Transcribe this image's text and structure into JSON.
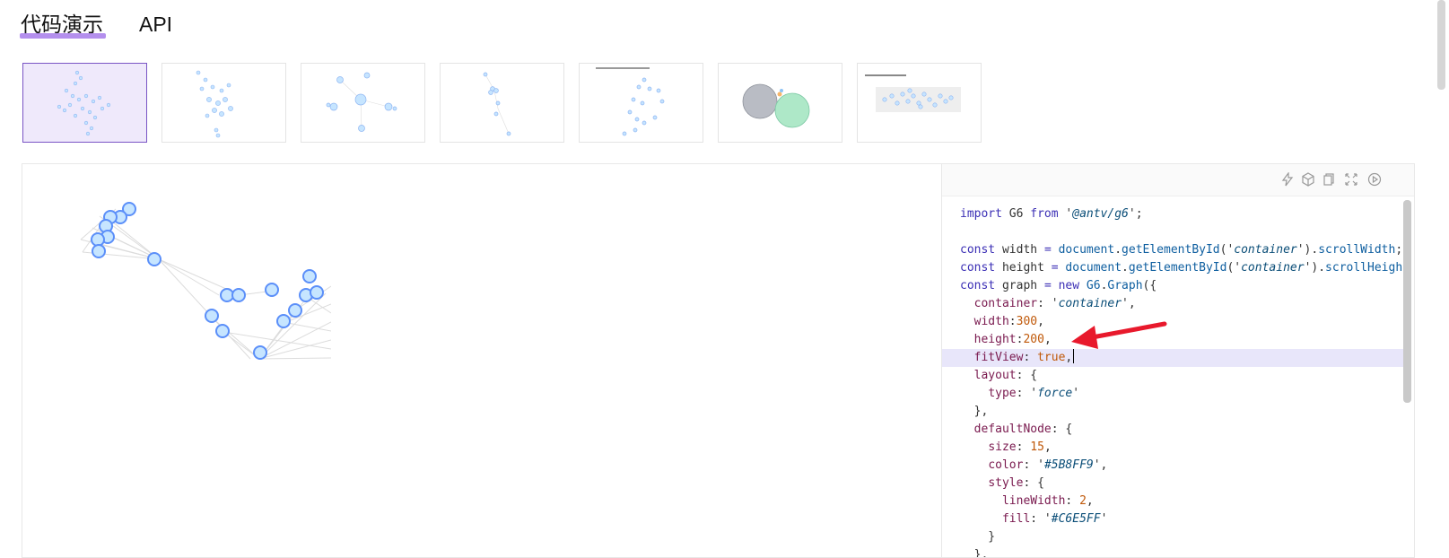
{
  "tabs": [
    {
      "label": "代码演示",
      "active": true
    },
    {
      "label": "API",
      "active": false
    }
  ],
  "colors": {
    "accent": "#a77bea",
    "node_fill": "#C6E5FF",
    "node_stroke": "#5B8FF9",
    "edge": "#d3d3d3",
    "highlight_line": "#e8e6fa",
    "arrow": "#e8192c"
  },
  "thumbnails": [
    {
      "name": "force-layout-demo-1",
      "active": true
    },
    {
      "name": "force-layout-demo-2",
      "active": false
    },
    {
      "name": "force-layout-demo-3",
      "active": false
    },
    {
      "name": "force-layout-demo-4",
      "active": false
    },
    {
      "name": "force-layout-demo-5",
      "active": false
    },
    {
      "name": "force-layout-demo-6",
      "active": false
    },
    {
      "name": "force-layout-demo-7",
      "active": false
    }
  ],
  "toolbar_icons": [
    "lightning-icon",
    "codesandbox-icon",
    "copy-icon",
    "fullscreen-icon",
    "play-icon"
  ],
  "code": {
    "highlighted_line": 9,
    "lines": [
      [
        [
          "kw",
          "import"
        ],
        [
          "plain",
          " G6 "
        ],
        [
          "kw",
          "from"
        ],
        [
          "plain",
          " '"
        ],
        [
          "str",
          "@antv/g6"
        ],
        [
          "plain",
          "';"
        ]
      ],
      [],
      [
        [
          "kw",
          "const"
        ],
        [
          "plain",
          " width "
        ],
        [
          "kw",
          "="
        ],
        [
          "plain",
          " "
        ],
        [
          "fn",
          "document"
        ],
        [
          "plain",
          "."
        ],
        [
          "fn",
          "getElementById"
        ],
        [
          "plain",
          "('"
        ],
        [
          "str",
          "container"
        ],
        [
          "plain",
          "')."
        ],
        [
          "fn",
          "scrollWidth"
        ],
        [
          "plain",
          ";"
        ]
      ],
      [
        [
          "kw",
          "const"
        ],
        [
          "plain",
          " height "
        ],
        [
          "kw",
          "="
        ],
        [
          "plain",
          " "
        ],
        [
          "fn",
          "document"
        ],
        [
          "plain",
          "."
        ],
        [
          "fn",
          "getElementById"
        ],
        [
          "plain",
          "('"
        ],
        [
          "str",
          "container"
        ],
        [
          "plain",
          "')."
        ],
        [
          "fn",
          "scrollHeigh"
        ]
      ],
      [
        [
          "kw",
          "const"
        ],
        [
          "plain",
          " graph "
        ],
        [
          "kw",
          "="
        ],
        [
          "plain",
          " "
        ],
        [
          "kw",
          "new"
        ],
        [
          "plain",
          " "
        ],
        [
          "fn",
          "G6"
        ],
        [
          "plain",
          "."
        ],
        [
          "fn",
          "Graph"
        ],
        [
          "plain",
          "({"
        ]
      ],
      [
        [
          "plain",
          "  "
        ],
        [
          "prop",
          "container"
        ],
        [
          "plain",
          ": '"
        ],
        [
          "str",
          "container"
        ],
        [
          "plain",
          "',"
        ]
      ],
      [
        [
          "plain",
          "  "
        ],
        [
          "prop",
          "width"
        ],
        [
          "plain",
          ":"
        ],
        [
          "num",
          "300"
        ],
        [
          "plain",
          ","
        ]
      ],
      [
        [
          "plain",
          "  "
        ],
        [
          "prop",
          "height"
        ],
        [
          "plain",
          ":"
        ],
        [
          "num",
          "200"
        ],
        [
          "plain",
          ","
        ]
      ],
      [
        [
          "plain",
          "  "
        ],
        [
          "prop",
          "fitView"
        ],
        [
          "plain",
          ": "
        ],
        [
          "num",
          "true"
        ],
        [
          "plain",
          ","
        ]
      ],
      [
        [
          "plain",
          "  "
        ],
        [
          "prop",
          "layout"
        ],
        [
          "plain",
          ": {"
        ]
      ],
      [
        [
          "plain",
          "    "
        ],
        [
          "prop",
          "type"
        ],
        [
          "plain",
          ": '"
        ],
        [
          "str",
          "force"
        ],
        [
          "plain",
          "'"
        ]
      ],
      [
        [
          "plain",
          "  },"
        ]
      ],
      [
        [
          "plain",
          "  "
        ],
        [
          "prop",
          "defaultNode"
        ],
        [
          "plain",
          ": {"
        ]
      ],
      [
        [
          "plain",
          "    "
        ],
        [
          "prop",
          "size"
        ],
        [
          "plain",
          ": "
        ],
        [
          "num",
          "15"
        ],
        [
          "plain",
          ","
        ]
      ],
      [
        [
          "plain",
          "    "
        ],
        [
          "prop",
          "color"
        ],
        [
          "plain",
          ": '"
        ],
        [
          "str",
          "#5B8FF9"
        ],
        [
          "plain",
          "',"
        ]
      ],
      [
        [
          "plain",
          "    "
        ],
        [
          "prop",
          "style"
        ],
        [
          "plain",
          ": {"
        ]
      ],
      [
        [
          "plain",
          "      "
        ],
        [
          "prop",
          "lineWidth"
        ],
        [
          "plain",
          ": "
        ],
        [
          "num",
          "2"
        ],
        [
          "plain",
          ","
        ]
      ],
      [
        [
          "plain",
          "      "
        ],
        [
          "prop",
          "fill"
        ],
        [
          "plain",
          ": '"
        ],
        [
          "str",
          "#C6E5FF"
        ],
        [
          "plain",
          "'"
        ]
      ],
      [
        [
          "plain",
          "    }"
        ]
      ],
      [
        [
          "plain",
          "  },"
        ]
      ]
    ]
  }
}
